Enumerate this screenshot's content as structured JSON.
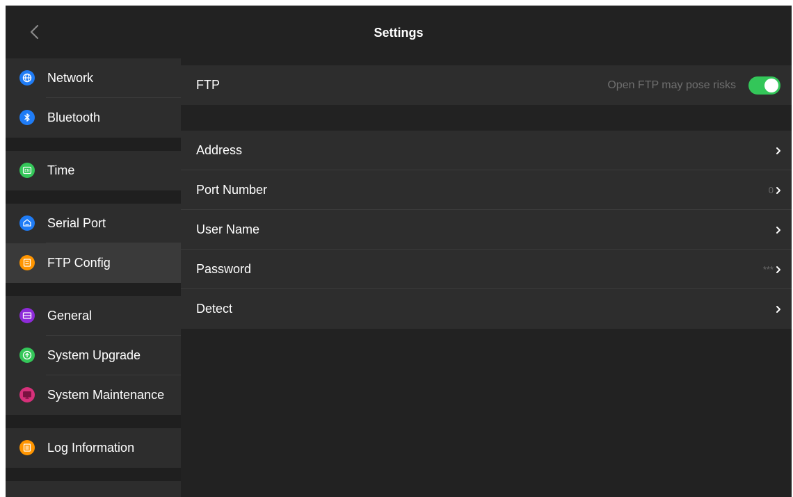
{
  "header": {
    "title": "Settings",
    "back_icon": "chevron-left-icon"
  },
  "sidebar": {
    "items": [
      {
        "label": "Network",
        "icon": "globe-icon",
        "color": "#1f7cf6"
      },
      {
        "label": "Bluetooth",
        "icon": "bluetooth-icon",
        "color": "#1f7cf6"
      },
      {
        "label": "Time",
        "icon": "language-icon",
        "color": "#34c759"
      },
      {
        "label": "Serial Port",
        "icon": "serial-port-icon",
        "color": "#1f7cf6"
      },
      {
        "label": "FTP Config",
        "icon": "ftp-icon",
        "color": "#ff9500",
        "active": true
      },
      {
        "label": "General",
        "icon": "general-icon",
        "color": "#8e2bd9"
      },
      {
        "label": "System Upgrade",
        "icon": "upgrade-icon",
        "color": "#34c759"
      },
      {
        "label": "System Maintenance",
        "icon": "maintenance-icon",
        "color": "#d6307a"
      },
      {
        "label": "Log Information",
        "icon": "log-icon",
        "color": "#ff9500"
      }
    ]
  },
  "ftp": {
    "label": "FTP",
    "hint": "Open FTP may pose risks",
    "enabled": true,
    "toggle_color": "#33c659"
  },
  "rows": [
    {
      "label": "Address",
      "value": ""
    },
    {
      "label": "Port Number",
      "value": "0"
    },
    {
      "label": "User Name",
      "value": ""
    },
    {
      "label": "Password",
      "value": "***"
    },
    {
      "label": "Detect",
      "value": ""
    }
  ]
}
